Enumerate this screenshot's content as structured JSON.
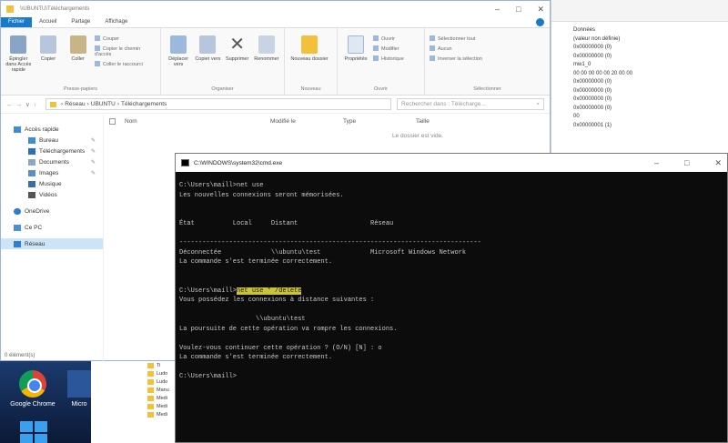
{
  "explorer": {
    "title": "\\\\UBUNTU\\Téléchargements",
    "menu": [
      "Fichier",
      "Accueil",
      "Partage",
      "Affichage"
    ],
    "ribbon": {
      "presse_papiers": {
        "name": "Presse-papiers",
        "buttons": [
          "Épingler dans Accès rapide",
          "Copier",
          "Coller"
        ],
        "small": [
          "Couper",
          "Copier le chemin d'accès",
          "Coller le raccourci"
        ]
      },
      "organiser": {
        "name": "Organiser",
        "buttons": [
          "Déplacer vers",
          "Copier vers",
          "Supprimer",
          "Renommer"
        ]
      },
      "nouveau": {
        "name": "Nouveau",
        "buttons": [
          "Nouveau dossier"
        ]
      },
      "ouvrir": {
        "name": "Ouvrir",
        "buttons": [
          "Propriétés"
        ],
        "small": [
          "Ouvrir",
          "Modifier",
          "Historique"
        ]
      },
      "selectionner": {
        "name": "Sélectionner",
        "small": [
          "Sélectionner tout",
          "Aucun",
          "Inverser la sélection"
        ]
      }
    },
    "address": {
      "path": [
        "Réseau",
        "UBUNTU",
        "Téléchargements"
      ],
      "search_placeholder": "Rechercher dans : Télécharge..."
    },
    "nav": {
      "quick_access": "Accès rapide",
      "items": [
        "Bureau",
        "Téléchargements",
        "Documents",
        "Images",
        "Musique",
        "Vidéos"
      ],
      "onedrive": "OneDrive",
      "thispc": "Ce PC",
      "network": "Réseau"
    },
    "columns": [
      "Nom",
      "Modifié le",
      "Type",
      "Taille"
    ],
    "empty_text": "Le dossier est vide.",
    "status": "0 élément(s)"
  },
  "side_panel": {
    "lines": [
      "Données",
      "(valeur non définie)",
      "0x00000000 (0)",
      "0x00000000 (0)",
      "mw1_0",
      "00 00 00 00 00 20 00 00",
      "0x00000000 (0)",
      "0x00000000 (0)",
      "0x00000000 (0)",
      "0x00000000 (0)",
      "00",
      "0x00000001 (1)"
    ]
  },
  "desktop": {
    "icons": [
      "Google Chrome",
      "Micro"
    ]
  },
  "folders": [
    "Ti",
    "Ludo",
    "Ludo",
    "Manu",
    "Medi",
    "Medi",
    "Medi"
  ],
  "cmd": {
    "title": "C:\\WINDOWS\\system32\\cmd.exe",
    "lines": [
      "C:\\Users\\maill>net use",
      "Les nouvelles connexions seront mémorisées.",
      "",
      "",
      "État          Local     Distant                   Réseau",
      "",
      "-------------------------------------------------------------------------------",
      "Déconnectée             \\\\ubuntu\\test             Microsoft Windows Network",
      "La commande s'est terminée correctement.",
      "",
      ""
    ],
    "prompt2": "C:\\Users\\maill>",
    "cmd2": "net use * /delete",
    "lines2": [
      "Vous possédez les connexions à distance suivantes :",
      "",
      "                    \\\\ubuntu\\test",
      "La poursuite de cette opération va rompre les connexions.",
      "",
      "Voulez-vous continuer cette opération ? (O/N) [N] : o",
      "La commande s'est terminée correctement.",
      "",
      "C:\\Users\\maill>"
    ]
  }
}
